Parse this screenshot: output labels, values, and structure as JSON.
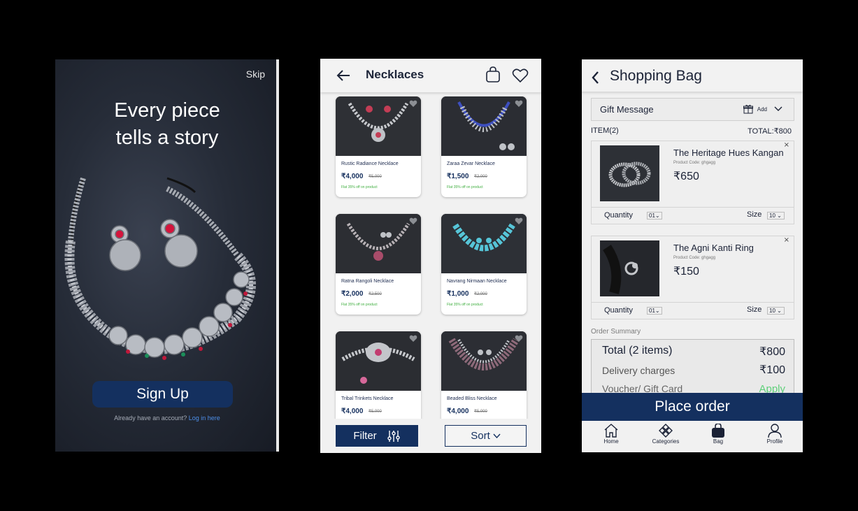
{
  "onboarding": {
    "skip_label": "Skip",
    "headline_line1": "Every piece",
    "headline_line2": "tells a story",
    "signup_label": "Sign Up",
    "login_prompt": "Already have an account?",
    "login_link": "Log in here"
  },
  "listing": {
    "title": "Necklaces",
    "filter_label": "Filter",
    "sort_label": "Sort",
    "products": [
      {
        "name": "Rustic Radiance Necklace",
        "price": "₹4,000",
        "mrp": "₹5,000",
        "offer": "Flat 35% off on product"
      },
      {
        "name": "Zaraa Zevar Necklace",
        "price": "₹1,500",
        "mrp": "₹2,000",
        "offer": "Flat 35% off on product"
      },
      {
        "name": "Ratna Rangoli Necklace",
        "price": "₹2,000",
        "mrp": "₹2,500",
        "offer": "Flat 35% off on product"
      },
      {
        "name": "Navrang Nirmaan Necklace",
        "price": "₹1,000",
        "mrp": "₹2,000",
        "offer": "Flat 35% off on product"
      },
      {
        "name": "Tribal Trinkets Necklace",
        "price": "₹4,000",
        "mrp": "₹5,000",
        "offer": ""
      },
      {
        "name": "Beaded Bliss Necklace",
        "price": "₹4,000",
        "mrp": "₹5,000",
        "offer": ""
      }
    ]
  },
  "bag": {
    "title": "Shopping Bag",
    "gift_label": "Gift Message",
    "gift_add": "Add",
    "items_count": "ITEM(2)",
    "total_label": "TOTAL:₹800",
    "items": [
      {
        "name": "The Heritage Hues Kangan",
        "code": "Product Code: ghgagg",
        "price": "₹650",
        "qty_label": "Quantity",
        "qty": "01",
        "size_label": "Size",
        "size": "10"
      },
      {
        "name": "The Agni Kanti Ring",
        "code": "Product Code: ghgagg",
        "price": "₹150",
        "qty_label": "Quantity",
        "qty": "01",
        "size_label": "Size",
        "size": "10"
      }
    ],
    "order_summary_label": "Order Summary",
    "summary": {
      "total_label": "Total (2 items)",
      "total_value": "₹800",
      "delivery_label": "Delivery charges",
      "delivery_value": "₹100",
      "voucher_label": "Voucher/ Gift Card",
      "voucher_action": "Apply"
    },
    "place_order_label": "Place order",
    "nav": [
      {
        "label": "Home",
        "icon": "home-icon"
      },
      {
        "label": "Categories",
        "icon": "categories-icon"
      },
      {
        "label": "Bag",
        "icon": "bag-icon"
      },
      {
        "label": "Profile",
        "icon": "profile-icon"
      }
    ]
  },
  "colors": {
    "primary": "#14305f",
    "offer_green": "#3fae3f",
    "link_blue": "#4d8ee8",
    "apply_green": "#5fd07a"
  }
}
